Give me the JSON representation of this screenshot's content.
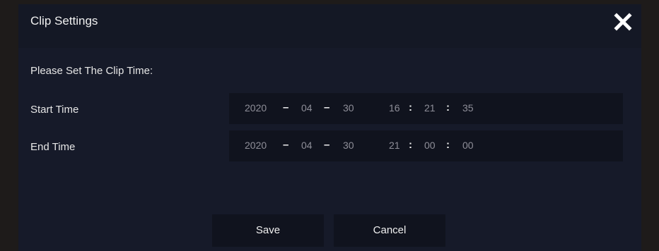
{
  "dialog": {
    "title": "Clip Settings",
    "prompt": "Please Set The Clip Time:"
  },
  "start_time": {
    "label": "Start Time",
    "year": "2020",
    "month": "04",
    "day": "30",
    "hour": "16",
    "minute": "21",
    "second": "35"
  },
  "end_time": {
    "label": "End Time",
    "year": "2020",
    "month": "04",
    "day": "30",
    "hour": "21",
    "minute": "00",
    "second": "00"
  },
  "separators": {
    "date": "–",
    "time": ":"
  },
  "buttons": {
    "save": "Save",
    "cancel": "Cancel"
  },
  "icons": {
    "close": "close-icon"
  },
  "colors": {
    "dialog_bg": "#161a29",
    "field_bg": "#10131e",
    "text": "#e6e6e6",
    "field_text": "#8e8e98"
  }
}
